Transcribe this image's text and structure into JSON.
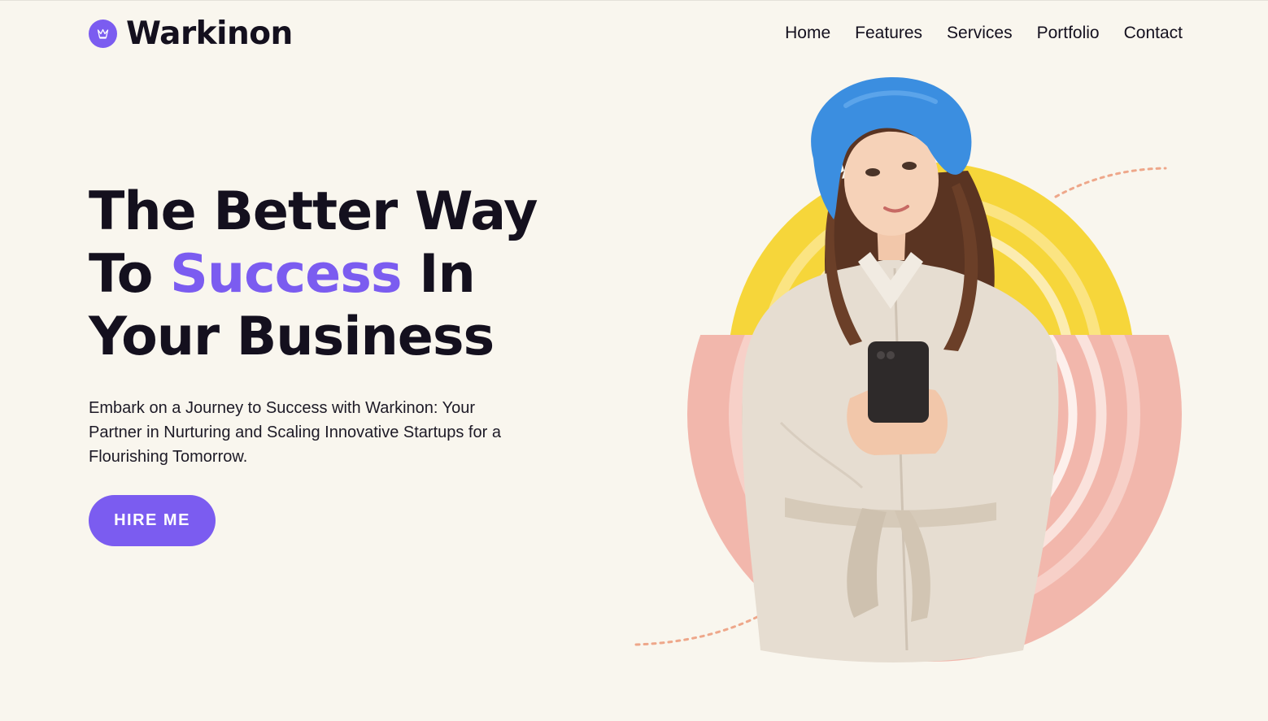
{
  "brand": {
    "name": "Warkinon",
    "logo_icon": "crown-icon",
    "accent_color": "#7b5cf0"
  },
  "nav": {
    "items": [
      {
        "label": "Home"
      },
      {
        "label": "Features"
      },
      {
        "label": "Services"
      },
      {
        "label": "Portfolio"
      },
      {
        "label": "Contact"
      }
    ]
  },
  "hero": {
    "headline_line1": "The Better Way",
    "headline_line2_prefix": "To ",
    "headline_line2_accent": "Success",
    "headline_line2_suffix": " In",
    "headline_line3": "Your Business",
    "description": "Embark on a Journey to Success with Warkinon: Your Partner in Nurturing and Scaling Innovative Startups for a Flourishing Tomorrow.",
    "cta_label": "HIRE ME"
  },
  "colors": {
    "background": "#f9f6ee",
    "text": "#14101e",
    "yellow_shape": "#f6d63a",
    "pink_shape": "#f2b7ac",
    "dash_accent": "#eea78a",
    "beret": "#3b8ee0"
  }
}
